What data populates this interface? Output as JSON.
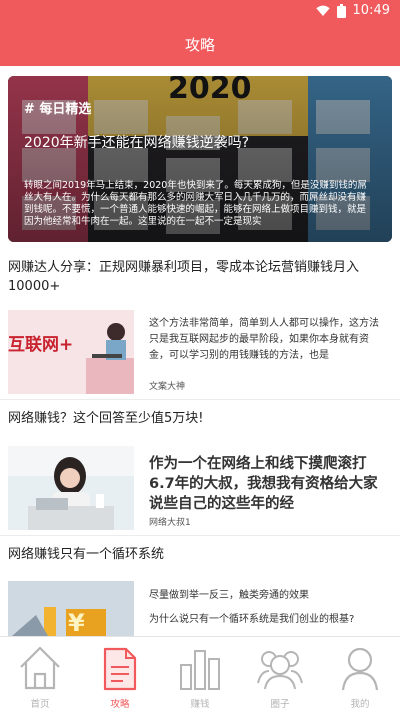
{
  "status_bar": {
    "time": "10:49"
  },
  "app_bar": {
    "title": "攻略"
  },
  "featured": {
    "tag": "# 每日精选",
    "title": "2020年新手还能在网络赚钱逆袭吗?",
    "description": "转眼之间2019年马上结束，2020年也快到来了。每天累成狗，但是没赚到钱的屌丝大有人在。为什么每天都有那么多的网赚大军日入几千几万的，而屌丝却没有赚到钱呢。不要慌，一个普通人能够快速的崛起，能够在网络上做项目赚到钱，就是因为他经常和牛肉在一起。这里说的在一起不一定是现实",
    "bg_year": "2020"
  },
  "articles": [
    {
      "title": "网赚达人分享：正规网赚暴利项目，零成本论坛营销赚钱月入10000+",
      "thumb_text": "互联网+",
      "snippet": "这个方法非常简单，简单到人人都可以操作，这方法只是我互联网起步的最早阶段，如果你本身就有资金，可以学习别的用钱赚钱的方法，也是",
      "author": "文案大神"
    },
    {
      "title": "网络赚钱？这个回答至少值5万块!",
      "snippet": "作为一个在网络上和线下摸爬滚打6.7年的大叔，我想我有资格给大家说些自己的这些年的经",
      "author": "网络大叔1"
    },
    {
      "title": "网络赚钱只有一个循环系统",
      "snippet_line1": "尽量做到举一反三，触类旁通的效果",
      "snippet_line2": "为什么说只有一个循环系统是我们创业的根基?"
    }
  ],
  "tabs": [
    {
      "label": "首页",
      "icon": "home-icon"
    },
    {
      "label": "攻略",
      "icon": "document-icon",
      "active": true
    },
    {
      "label": "赚钱",
      "icon": "bar-chart-icon"
    },
    {
      "label": "圈子",
      "icon": "group-icon"
    },
    {
      "label": "我的",
      "icon": "user-icon"
    }
  ],
  "colors": {
    "accent": "#f05a5c",
    "tab_inactive": "#b5b5b5"
  }
}
